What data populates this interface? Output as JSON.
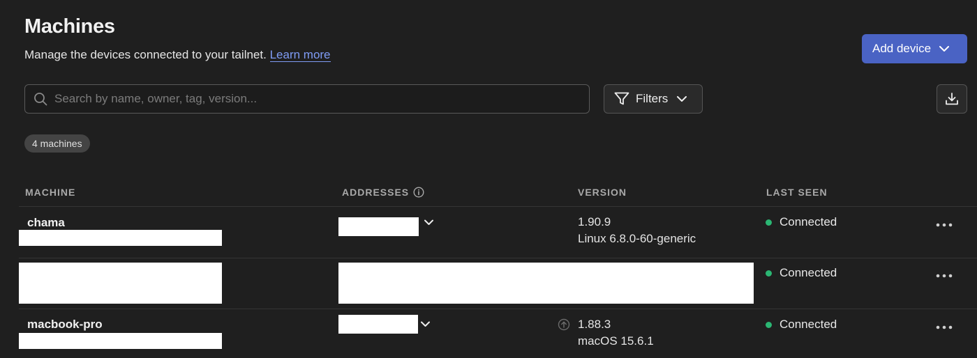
{
  "header": {
    "title": "Machines",
    "subtitle": "Manage the devices connected to your tailnet.",
    "learn_more": "Learn more",
    "add_device": "Add device"
  },
  "toolbar": {
    "search_placeholder": "Search by name, owner, tag, version...",
    "filters_label": "Filters"
  },
  "summary": {
    "count_label": "4 machines"
  },
  "table": {
    "columns": [
      "MACHINE",
      "ADDRESSES",
      "VERSION",
      "LAST SEEN"
    ],
    "rows": [
      {
        "name": "chama",
        "version": "1.90.9",
        "os": "Linux 6.8.0-60-generic",
        "last_seen": "Connected"
      },
      {
        "name": "",
        "version": "",
        "os": "",
        "last_seen": "Connected"
      },
      {
        "name": "macbook-pro",
        "version": "1.88.3",
        "os": "macOS 15.6.1",
        "last_seen": "Connected",
        "update_available": true
      }
    ]
  },
  "icons": {
    "search": "search-icon",
    "filter": "filter-icon",
    "download": "download-icon",
    "chevron": "chevron-down-icon",
    "info": "info-icon",
    "more": "more-icon",
    "update": "update-available-icon"
  },
  "colors": {
    "accent": "#4a63c4",
    "link": "#7f9cf5",
    "connected": "#2bb673",
    "background": "#1f1f1f"
  }
}
